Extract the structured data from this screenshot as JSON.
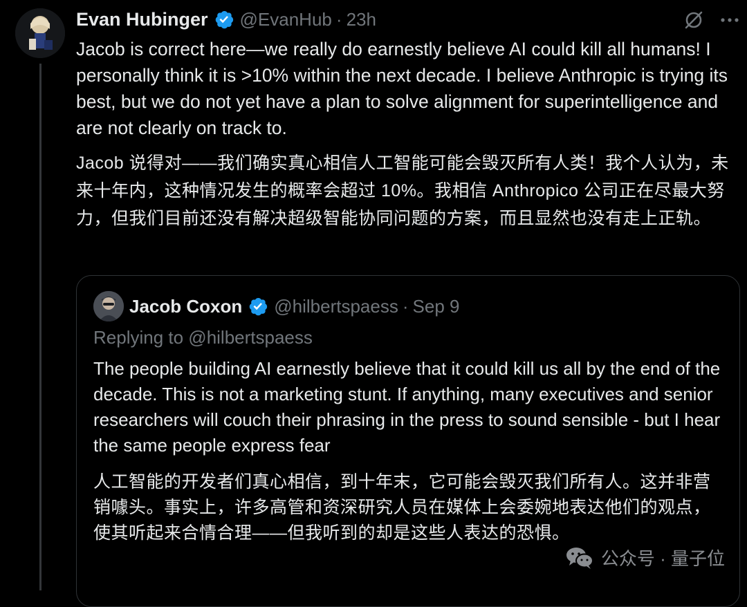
{
  "tweet": {
    "display_name": "Evan Hubinger",
    "handle": "@EvanHub",
    "separator": "·",
    "time": "23h",
    "text": "Jacob is correct here—we really do earnestly believe AI could kill all humans! I personally think it is >10% within the next decade. I believe Anthropic is trying its best, but we do not yet have a plan to solve alignment for superintelligence and are not clearly on track to.",
    "translation": "Jacob 说得对——我们确实真心相信人工智能可能会毁灭所有人类！我个人认为，未来十年内，这种情况发生的概率会超过 10%。我相信 Anthropico 公司正在尽最大努力，但我们目前还没有解决超级智能协同问题的方案，而且显然也没有走上正轨。",
    "icons": [
      "grok-icon",
      "more-icon",
      "verified-badge-icon"
    ]
  },
  "quote": {
    "display_name": "Jacob Coxon",
    "handle": "@hilbertspaess",
    "separator": "·",
    "date": "Sep 9",
    "replying_to": "Replying to @hilbertspaess",
    "text": "The people building AI earnestly believe that it could kill us all by the end of the decade. This is not a marketing stunt. If anything, many executives and senior researchers will couch their phrasing in the press to sound sensible - but I hear the same people express fear",
    "translation": "人工智能的开发者们真心相信，到十年末，它可能会毁灭我们所有人。这并非营销噱头。事实上，许多高管和资深研究人员在媒体上会委婉地表达他们的观点，使其听起来合情合理——但我听到的却是这些人表达的恐惧。"
  },
  "watermark": {
    "text": "公众号 · 量子位",
    "icon": "wechat-icon"
  },
  "colors": {
    "background": "#000000",
    "text": "#e7e9ea",
    "muted": "#71767b",
    "verified": "#1d9bf0",
    "border": "#2f3336"
  }
}
